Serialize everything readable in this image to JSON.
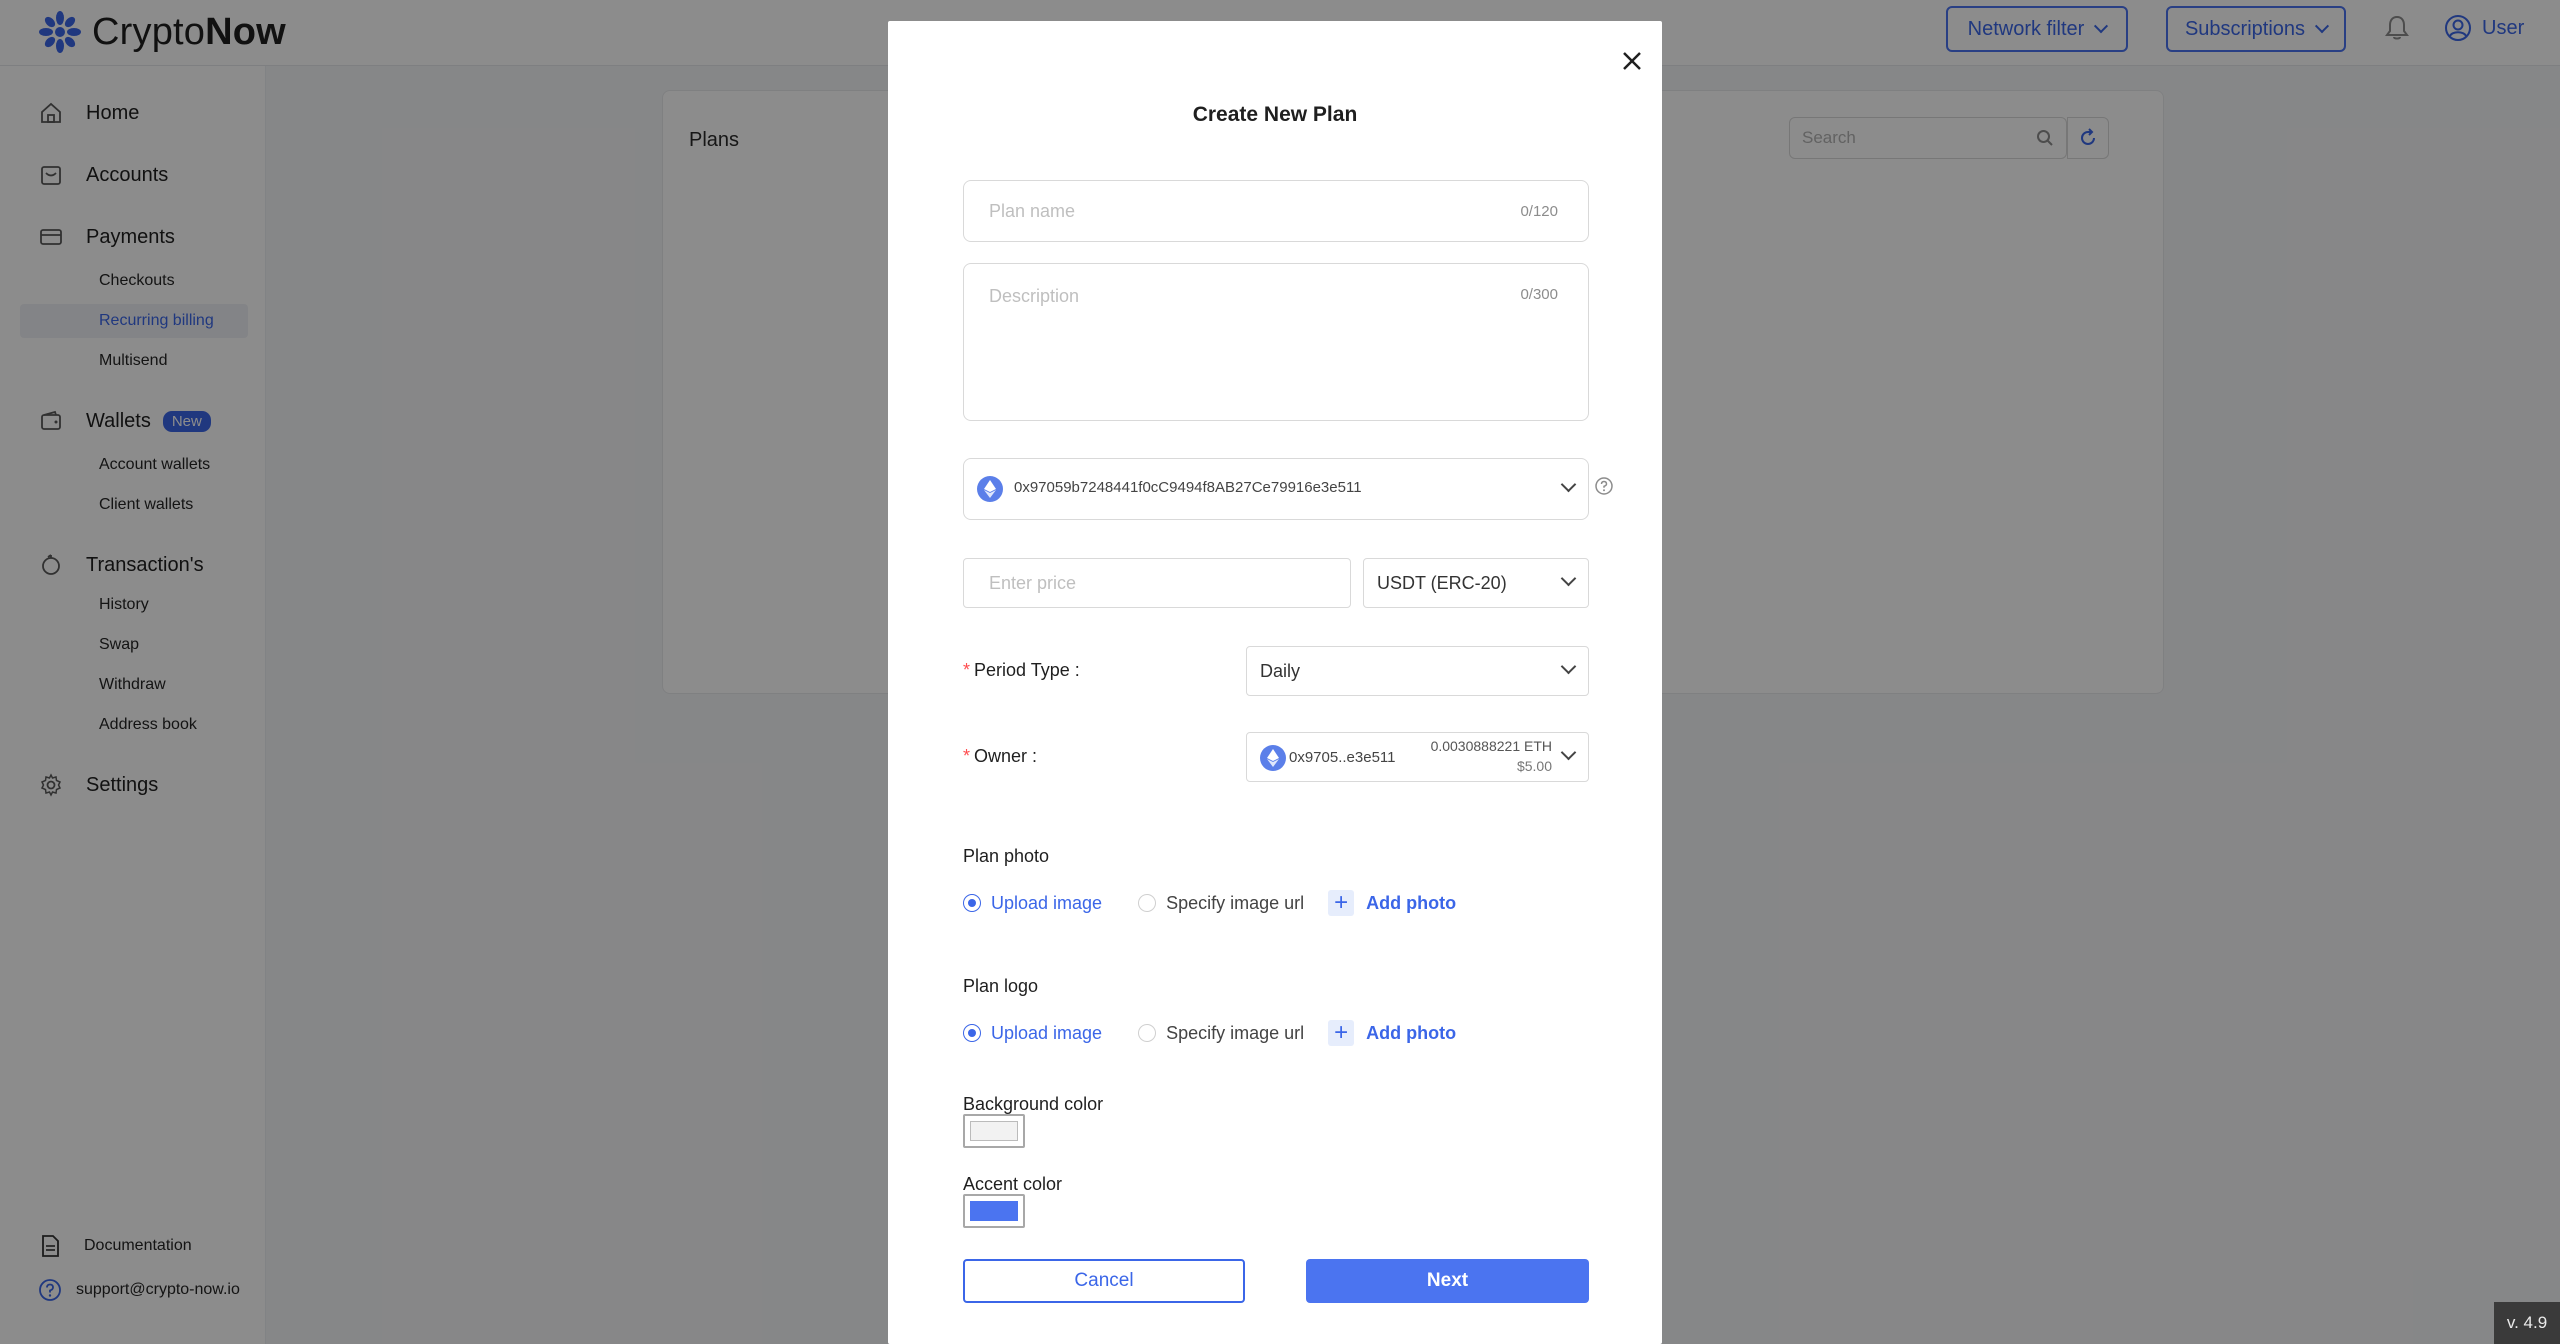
{
  "app": {
    "logo_text_light": "Crypto",
    "logo_text_bold": "Now",
    "accent_color": "#3b66e8",
    "version": "v. 4.9"
  },
  "topbar": {
    "network_filter_label": "Network filter",
    "subscriptions_label": "Subscriptions",
    "user_label": "User"
  },
  "sidebar": {
    "home": "Home",
    "accounts": "Accounts",
    "payments": "Payments",
    "checkouts": "Checkouts",
    "recurring_billing": "Recurring billing",
    "multisend": "Multisend",
    "wallets": "Wallets",
    "wallets_badge": "New",
    "account_wallets": "Account wallets",
    "client_wallets": "Client wallets",
    "transactions": "Transaction's",
    "history": "History",
    "swap": "Swap",
    "withdraw": "Withdraw",
    "address_book": "Address book",
    "settings": "Settings",
    "documentation": "Documentation",
    "support_email": "support@crypto-now.io"
  },
  "content": {
    "card_title": "Plans",
    "search_placeholder": "Search"
  },
  "modal": {
    "title": "Create New Plan",
    "plan_name_placeholder": "Plan name",
    "plan_name_counter": "0/120",
    "description_placeholder": "Description",
    "description_counter": "0/300",
    "wallet_address": "0x97059b7248441f0cC9494f8AB27Ce79916e3e511",
    "price_placeholder": "Enter price",
    "currency": "USDT (ERC-20)",
    "period_type_label": "Period Type",
    "period_type_value": "Daily",
    "owner_label": "Owner",
    "owner_short": "0x9705..e3e511",
    "owner_balance": "0.0030888221 ETH",
    "owner_usd": "$5.00",
    "plan_photo_label": "Plan photo",
    "plan_logo_label": "Plan logo",
    "upload_image": "Upload image",
    "specify_url": "Specify image url",
    "add_photo": "Add photo",
    "bg_color_label": "Background color",
    "bg_color_value": "#f2f2f2",
    "accent_color_label": "Accent color",
    "accent_color_value": "#4b74f0",
    "cancel": "Cancel",
    "next": "Next"
  }
}
